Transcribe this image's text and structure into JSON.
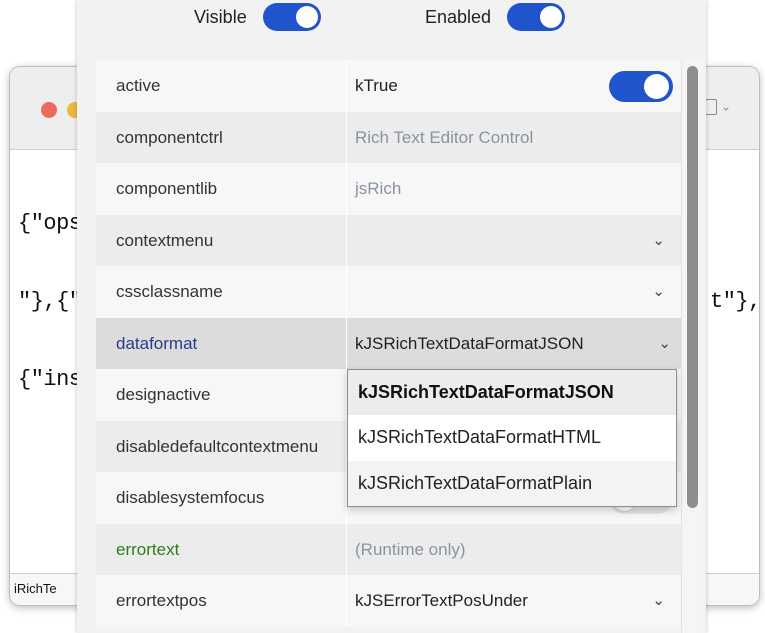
{
  "background_window": {
    "content_lines": [
      "{\"ops",
      "\"},{\"a",
      "{\"inse"
    ],
    "content_right_fragment": "t\"},",
    "status_text": "iRichTe"
  },
  "inspector": {
    "top_toggles": [
      {
        "label": "Visible",
        "state": "on"
      },
      {
        "label": "Enabled",
        "state": "on"
      }
    ],
    "properties": [
      {
        "name": "active",
        "value": "kTrue",
        "control": "switch-on"
      },
      {
        "name": "componentctrl",
        "value": "Rich Text Editor Control",
        "value_style": "grey"
      },
      {
        "name": "componentlib",
        "value": "jsRich",
        "value_style": "grey"
      },
      {
        "name": "contextmenu",
        "value": "",
        "control": "dropdown"
      },
      {
        "name": "cssclassname",
        "value": "",
        "control": "dropdown"
      },
      {
        "name": "dataformat",
        "value": "kJSRichTextDataFormatJSON",
        "control": "dropdown",
        "selected": true
      },
      {
        "name": "designactive",
        "value": ""
      },
      {
        "name": "disabledefaultcontextmenu",
        "value": ""
      },
      {
        "name": "disablesystemfocus",
        "value": "",
        "control": "switch-off"
      },
      {
        "name": "errortext",
        "value": "(Runtime only)",
        "value_style": "grey"
      },
      {
        "name": "errortextpos",
        "value": "kJSErrorTextPosUnder",
        "control": "dropdown"
      }
    ],
    "dropdown_options": [
      {
        "label": "kJSRichTextDataFormatJSON",
        "selected": true
      },
      {
        "label": "kJSRichTextDataFormatHTML",
        "selected": false
      },
      {
        "label": "kJSRichTextDataFormatPlain",
        "selected": false
      }
    ],
    "colors": {
      "switch_on": "#2054cc",
      "name_highlight": "#2b3a8e",
      "name_runtime": "#2e7d1f"
    }
  }
}
